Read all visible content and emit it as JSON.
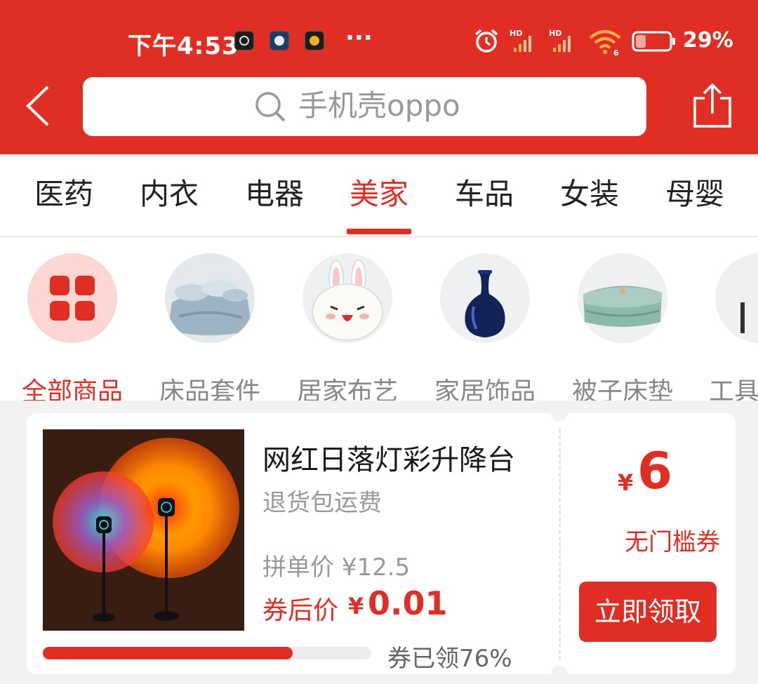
{
  "status_bar": {
    "time": "下午4:53",
    "more": "···",
    "battery": "29%",
    "signal_label_1": "HD",
    "signal_label_2": "HD",
    "wifi_label": "6"
  },
  "search": {
    "placeholder": "手机壳oppo"
  },
  "tabs": [
    {
      "label": "医药"
    },
    {
      "label": "内衣"
    },
    {
      "label": "电器"
    },
    {
      "label": "美家",
      "active": true
    },
    {
      "label": "车品"
    },
    {
      "label": "女装"
    },
    {
      "label": "母婴"
    }
  ],
  "subcategories": [
    {
      "label": "全部商品",
      "icon": "grid-icon",
      "active": true
    },
    {
      "label": "床品套件",
      "icon": "bedding-image"
    },
    {
      "label": "居家布艺",
      "icon": "bunny-pillow-image"
    },
    {
      "label": "家居饰品",
      "icon": "vase-image"
    },
    {
      "label": "被子床垫",
      "icon": "quilt-image"
    },
    {
      "label": "工具",
      "icon": "tools-image"
    }
  ],
  "product": {
    "title": "网红日落灯彩升降台",
    "subtitle": "退货包运费",
    "group_price": "拼单价 ¥12.5",
    "after_coupon_label": "券后价",
    "currency": "¥",
    "after_coupon_price": "0.01",
    "claimed_text": "券已领76%",
    "claimed_ratio": 0.76,
    "coupon": {
      "currency": "¥",
      "value": "6",
      "type": "无门槛券",
      "button": "立即领取"
    }
  },
  "colors": {
    "brand_red": "#e02e24",
    "muted_text": "#999999"
  }
}
